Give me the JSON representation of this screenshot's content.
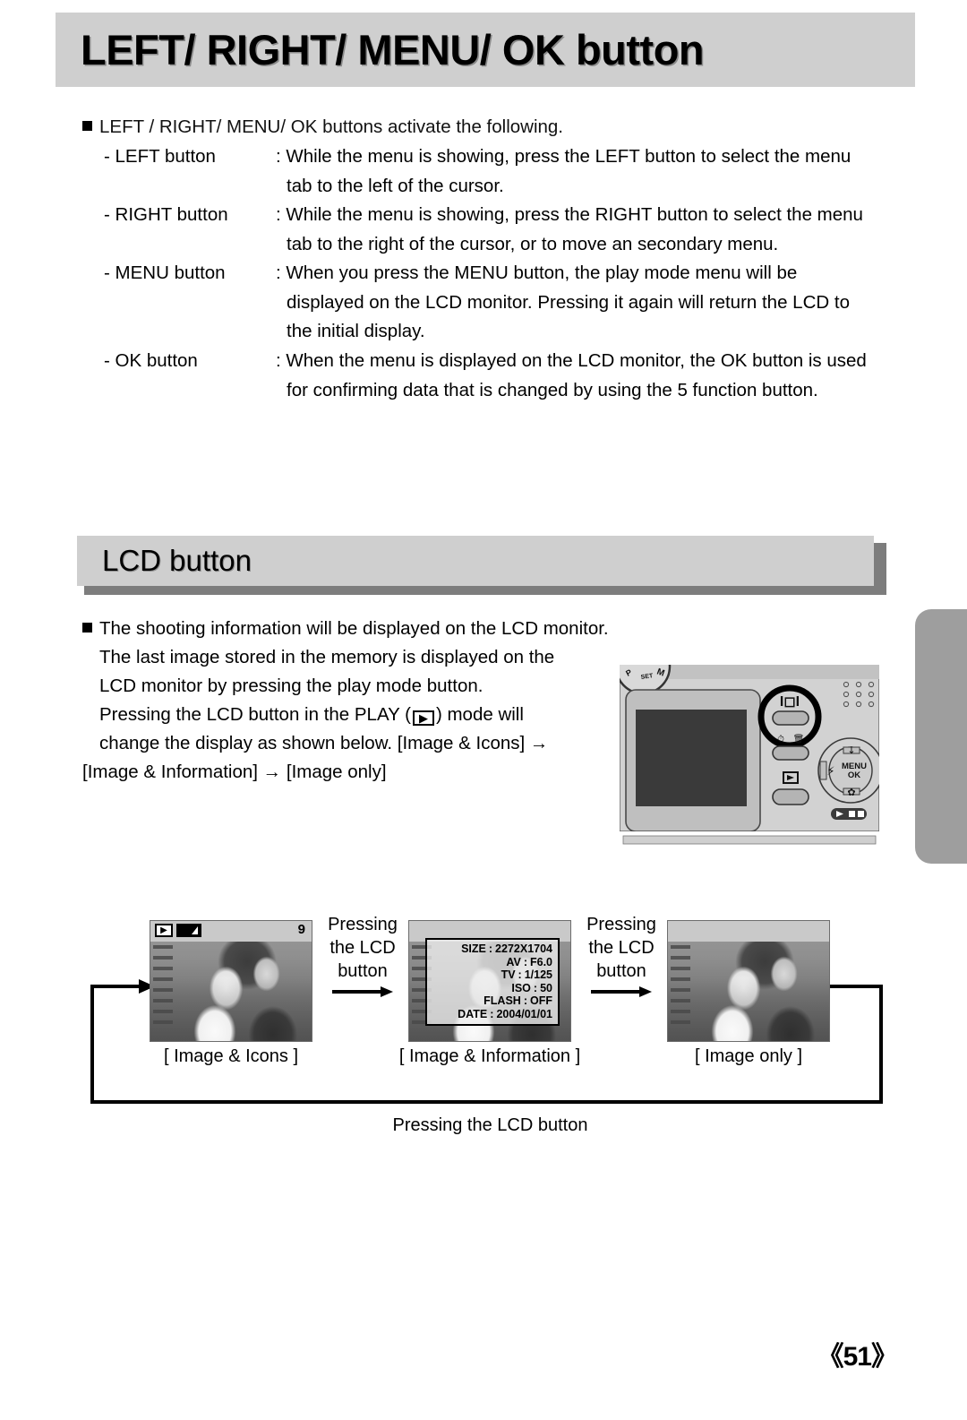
{
  "header": {
    "title": "LEFT/ RIGHT/ MENU/ OK button"
  },
  "intro": {
    "bullet_text": "LEFT / RIGHT/ MENU/ OK buttons activate the following."
  },
  "definitions": [
    {
      "term": "- LEFT button",
      "lines": [
        ": While the menu is showing, press the LEFT button to select the menu",
        "tab to the left of the cursor."
      ]
    },
    {
      "term": "- RIGHT button",
      "lines": [
        ": While the menu is showing, press the RIGHT button to select the menu",
        "tab to the right of the cursor, or to move an secondary menu."
      ]
    },
    {
      "term": "- MENU button",
      "lines": [
        ": When you press the MENU button, the play mode menu will be",
        "displayed on the LCD monitor. Pressing it again will return the LCD to",
        "the initial display."
      ]
    },
    {
      "term": "- OK button",
      "lines": [
        ": When the menu is displayed on the LCD monitor, the OK button is used",
        "for confirming data that is changed by using the 5 function button."
      ]
    }
  ],
  "lcd_section": {
    "heading": "LCD button",
    "paragraph_lines": [
      "The shooting information will be displayed on the LCD monitor.",
      "The last image stored in the memory is displayed on the",
      "LCD monitor by pressing the play mode button.",
      "Pressing the LCD button in the PLAY (",
      ") mode will",
      "change the display as shown below. [Image & Icons] →",
      "[Image & Information] → [Image only]"
    ],
    "play_icon_glyph": "▶"
  },
  "camera": {
    "lcd_button_icon": "IOI",
    "play_button_icon": "▶",
    "menu_ok_label_line1": "MENU",
    "menu_ok_label_line2": "OK",
    "flash_icon": "⚡",
    "macro_icon": "❀",
    "self_timer_icon": "⏱",
    "mode_dial_labels": [
      "P",
      "SET",
      "M"
    ],
    "play_rec_switch": "▶/■"
  },
  "flow": {
    "shots": [
      {
        "caption": "[ Image & Icons ]",
        "overlay": "icons",
        "play_icon": "▶",
        "frame_count": "9"
      },
      {
        "caption": "[ Image & Information ]",
        "overlay": "info",
        "info_rows": [
          {
            "key": "SIZE",
            "sep": ":",
            "value": "2272X1704"
          },
          {
            "key": "AV",
            "sep": ":",
            "value": "F6.0"
          },
          {
            "key": "TV",
            "sep": ":",
            "value": "1/125"
          },
          {
            "key": "ISO",
            "sep": ":",
            "value": "50"
          },
          {
            "key": "FLASH",
            "sep": ":",
            "value": "OFF"
          },
          {
            "key": "DATE",
            "sep": ":",
            "value": "2004/01/01"
          }
        ]
      },
      {
        "caption": "[ Image only ]",
        "overlay": "none"
      }
    ],
    "transitions": [
      {
        "lines": [
          "Pressing",
          "the LCD",
          "button"
        ]
      },
      {
        "lines": [
          "Pressing",
          "the LCD",
          "button"
        ]
      }
    ],
    "footer": "Pressing the LCD button"
  },
  "page": {
    "number": "《51》"
  }
}
